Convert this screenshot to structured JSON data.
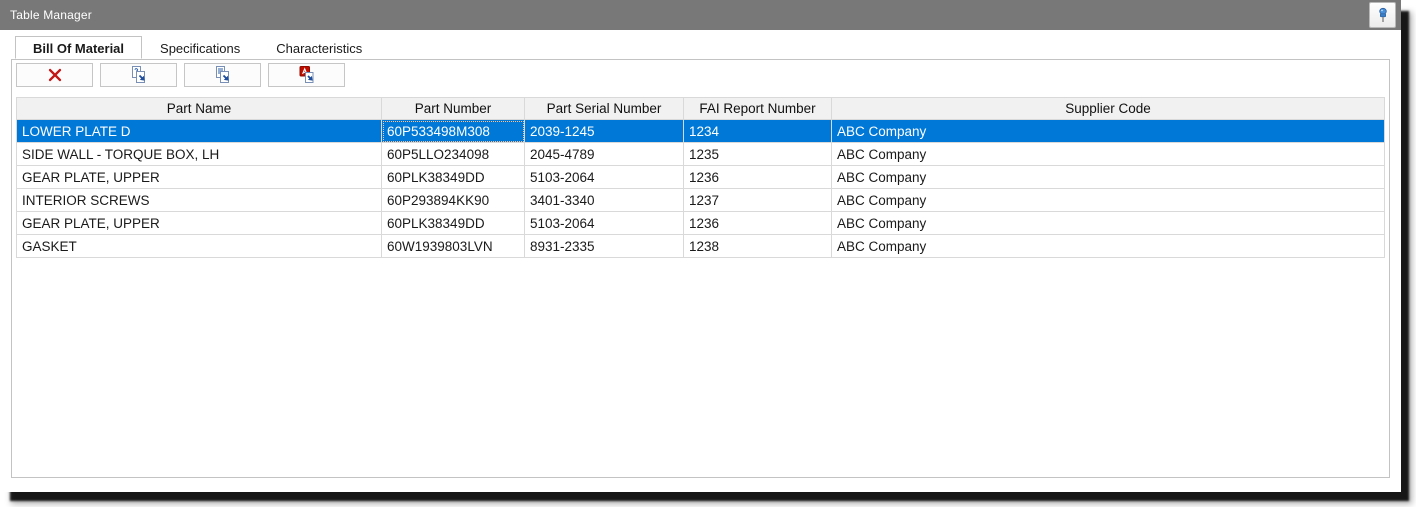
{
  "window": {
    "title": "Table Manager"
  },
  "titlebar": {
    "pin_icon": "pushpin"
  },
  "tabs": [
    {
      "id": "bill-of-material",
      "label": "Bill Of Material",
      "active": true
    },
    {
      "id": "specifications",
      "label": "Specifications",
      "active": false
    },
    {
      "id": "characteristics",
      "label": "Characteristics",
      "active": false
    }
  ],
  "toolbar": {
    "buttons": [
      {
        "id": "delete-row",
        "icon": "red-x-icon"
      },
      {
        "id": "export-document",
        "icon": "export-page-icon"
      },
      {
        "id": "export-list",
        "icon": "export-list-icon"
      },
      {
        "id": "export-pdf",
        "icon": "export-pdf-icon"
      }
    ]
  },
  "table": {
    "columns": [
      "Part Name",
      "Part Number",
      "Part Serial Number",
      "FAI Report Number",
      "Supplier Code"
    ],
    "rows": [
      [
        "LOWER PLATE D",
        "60P533498M308",
        "2039-1245",
        "1234",
        "ABC Company"
      ],
      [
        "SIDE WALL - TORQUE BOX, LH",
        "60P5LLO234098",
        "2045-4789",
        "1235",
        "ABC Company"
      ],
      [
        "GEAR PLATE, UPPER",
        "60PLK38349DD",
        "5103-2064",
        "1236",
        "ABC Company"
      ],
      [
        "INTERIOR SCREWS",
        "60P293894KK90",
        "3401-3340",
        "1237",
        "ABC Company"
      ],
      [
        "GEAR PLATE, UPPER",
        "60PLK38349DD",
        "5103-2064",
        "1236",
        "ABC Company"
      ],
      [
        "GASKET",
        "60W1939803LVN",
        "8931-2335",
        "1238",
        "ABC Company"
      ]
    ],
    "selected_row_index": 0,
    "focused_cell": {
      "row": 0,
      "col": 1
    }
  },
  "colors": {
    "titlebar_gray": "#787878",
    "selection_blue": "#0078d7",
    "selection_text": "#ffffff",
    "header_bg": "#f1f1f1",
    "grid_border": "#d9d9d9",
    "delete_red": "#c41616",
    "icon_blue": "#1f4e9c",
    "pdf_red": "#c00d00",
    "focus_dotted": "#ffc08a"
  }
}
